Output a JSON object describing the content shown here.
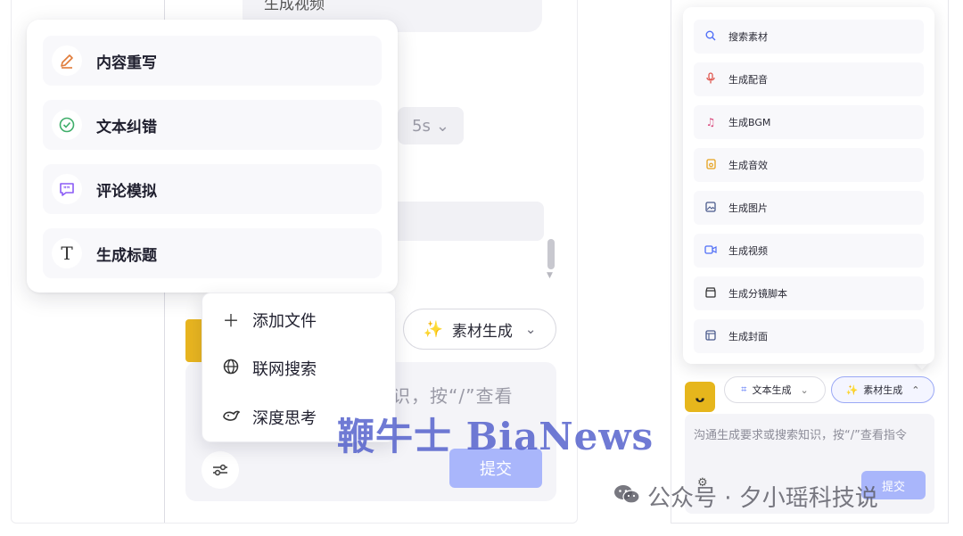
{
  "left": {
    "background": {
      "video_text": "生成视频",
      "duration_value": "5s",
      "input_hint": "识，按“/”查看",
      "material_button_label": "素材生成",
      "submit_label": "提交"
    },
    "rewrite_menu": {
      "items": [
        {
          "label": "内容重写",
          "icon": "pen-icon",
          "color": "#e07b39"
        },
        {
          "label": "文本纠错",
          "icon": "check-circle-icon",
          "color": "#3fae6a"
        },
        {
          "label": "评论模拟",
          "icon": "quote-icon",
          "color": "#8b5cf6"
        },
        {
          "label": "生成标题",
          "icon": "text-t-icon",
          "color": "#333333"
        }
      ]
    },
    "attach_menu": {
      "items": [
        {
          "label": "添加文件",
          "icon": "plus-icon"
        },
        {
          "label": "联网搜索",
          "icon": "globe-icon"
        },
        {
          "label": "深度思考",
          "icon": "whale-icon"
        }
      ]
    }
  },
  "right": {
    "asset_menu": {
      "items": [
        {
          "label": "搜索素材",
          "icon": "search-icon",
          "color": "#4f6ef7"
        },
        {
          "label": "生成配音",
          "icon": "microphone-icon",
          "color": "#e0574f"
        },
        {
          "label": "生成BGM",
          "icon": "music-note-icon",
          "color": "#d9467a"
        },
        {
          "label": "生成音效",
          "icon": "sound-effect-icon",
          "color": "#e6a21c"
        },
        {
          "label": "生成图片",
          "icon": "image-icon",
          "color": "#4a5a8c"
        },
        {
          "label": "生成视频",
          "icon": "video-camera-icon",
          "color": "#4f6ef7"
        },
        {
          "label": "生成分镜脚本",
          "icon": "clapperboard-icon",
          "color": "#333333"
        },
        {
          "label": "生成封面",
          "icon": "layout-icon",
          "color": "#4a5a8c"
        }
      ]
    },
    "text_gen_label": "文本生成",
    "asset_gen_label": "素材生成",
    "input_hint": "沟通生成要求或搜索知识，按“/”查看指令",
    "submit_label": "提交"
  },
  "watermarks": {
    "bianews": "鞭牛士 BiaNews",
    "wechat": "公众号 · 夕小瑶科技说"
  },
  "colors": {
    "accent": "#a9b6fb",
    "sparkle": "#8b5cf6",
    "avatar": "#e6b61c"
  }
}
